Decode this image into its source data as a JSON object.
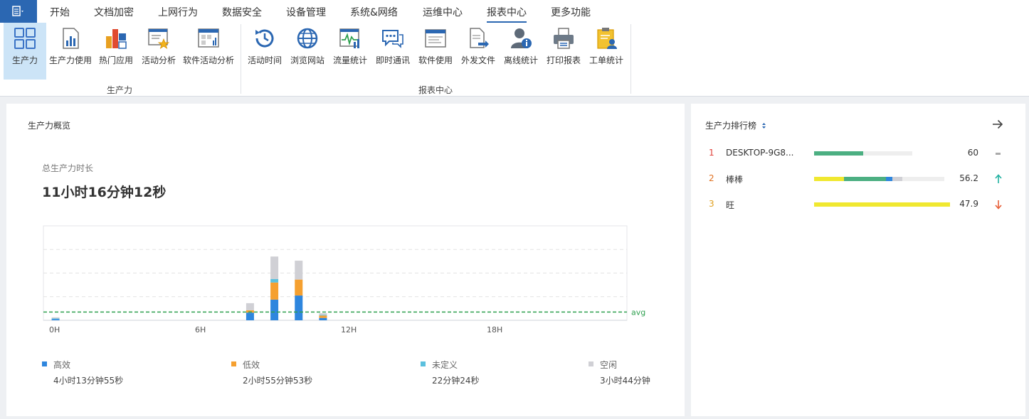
{
  "colors": {
    "accent": "#2b67b2",
    "high": "#2e86de",
    "low": "#f5a030",
    "undefined": "#5bc0de",
    "idle": "#d0d0d5",
    "avg_line": "#2ea04f",
    "rank1": "#e0403a",
    "rank2": "#e07020",
    "rank3": "#e0a020",
    "bar_green": "#4caf82",
    "bar_yellow": "#f0e830"
  },
  "menu": {
    "app_icon": "document-menu-icon",
    "items": [
      {
        "label": "开始",
        "active": false
      },
      {
        "label": "文档加密",
        "active": false
      },
      {
        "label": "上网行为",
        "active": false
      },
      {
        "label": "数据安全",
        "active": false
      },
      {
        "label": "设备管理",
        "active": false
      },
      {
        "label": "系统&网络",
        "active": false
      },
      {
        "label": "运维中心",
        "active": false
      },
      {
        "label": "报表中心",
        "active": true
      },
      {
        "label": "更多功能",
        "active": false
      }
    ]
  },
  "ribbon": {
    "groups": [
      {
        "label": "生产力"
      },
      {
        "label": "报表中心"
      }
    ],
    "tools": [
      {
        "label": "生产力",
        "icon": "productivity-grid-icon",
        "selected": true
      },
      {
        "label": "生产力使用",
        "icon": "bar-report-icon",
        "selected": false
      },
      {
        "label": "热门应用",
        "icon": "popular-apps-icon",
        "selected": false
      },
      {
        "label": "活动分析",
        "icon": "activity-star-icon",
        "selected": false
      },
      {
        "label": "软件活动分析",
        "icon": "software-activity-icon",
        "selected": false
      },
      {
        "label": "活动时间",
        "icon": "history-clock-icon",
        "selected": false
      },
      {
        "label": "浏览网站",
        "icon": "globe-icon",
        "selected": false
      },
      {
        "label": "流量统计",
        "icon": "traffic-chart-icon",
        "selected": false
      },
      {
        "label": "即时通讯",
        "icon": "chat-bubbles-icon",
        "selected": false
      },
      {
        "label": "软件使用",
        "icon": "software-window-icon",
        "selected": false
      },
      {
        "label": "外发文件",
        "icon": "outgoing-file-icon",
        "selected": false
      },
      {
        "label": "离线统计",
        "icon": "offline-user-icon",
        "selected": false
      },
      {
        "label": "打印报表",
        "icon": "printer-icon",
        "selected": false
      },
      {
        "label": "工单统计",
        "icon": "work-order-icon",
        "selected": false
      }
    ]
  },
  "overview": {
    "title": "生产力概览",
    "total_label": "总生产力时长",
    "total_value": "11小时16分钟12秒"
  },
  "chart_data": {
    "type": "bar",
    "stacked": true,
    "x": [
      0,
      1,
      2,
      3,
      4,
      5,
      6,
      7,
      8,
      9,
      10,
      11,
      12,
      13,
      14,
      15,
      16,
      17,
      18,
      19,
      20,
      21,
      22,
      23
    ],
    "x_tick_labels": [
      "0H",
      "6H",
      "12H",
      "18H"
    ],
    "series": [
      {
        "name": "高效",
        "color_key": "high",
        "values": [
          2,
          0,
          0,
          0,
          0,
          0,
          0,
          0,
          13,
          35,
          42,
          4,
          0,
          0,
          0,
          0,
          0,
          0,
          0,
          0,
          0,
          0,
          0,
          0
        ]
      },
      {
        "name": "低效",
        "color_key": "low",
        "values": [
          0,
          0,
          0,
          0,
          0,
          0,
          0,
          0,
          4,
          29,
          27,
          4,
          0,
          0,
          0,
          0,
          0,
          0,
          0,
          0,
          0,
          0,
          0,
          0
        ]
      },
      {
        "name": "未定义",
        "color_key": "undefined",
        "values": [
          1,
          0,
          0,
          0,
          0,
          0,
          0,
          0,
          0,
          6,
          0,
          1,
          0,
          0,
          0,
          0,
          0,
          0,
          0,
          0,
          0,
          0,
          0,
          0
        ]
      },
      {
        "name": "空闲",
        "color_key": "idle",
        "values": [
          2,
          0,
          0,
          0,
          0,
          0,
          0,
          0,
          12,
          38,
          32,
          3,
          0,
          0,
          0,
          0,
          0,
          0,
          0,
          0,
          0,
          0,
          0,
          0
        ]
      }
    ],
    "ylim": [
      0,
      160
    ],
    "avg": 14,
    "avg_label": "avg",
    "grid": true
  },
  "legend": [
    {
      "name": "高效",
      "value": "4小时13分钟55秒",
      "color_key": "high"
    },
    {
      "name": "低效",
      "value": "2小时55分钟53秒",
      "color_key": "low"
    },
    {
      "name": "未定义",
      "value": "22分钟24秒",
      "color_key": "undefined"
    },
    {
      "name": "空闲",
      "value": "3小时44分钟",
      "color_key": "idle"
    }
  ],
  "ranking": {
    "title": "生产力排行榜",
    "sort_icon": "sort-updown-icon",
    "arrow_icon": "arrow-right-icon",
    "rows": [
      {
        "rank": "1",
        "name": "DESKTOP-9G8...",
        "score": "60",
        "trend": "flat",
        "segments": [
          {
            "share": 0.5,
            "color_key": "bar_green"
          }
        ]
      },
      {
        "rank": "2",
        "name": "棒棒",
        "score": "56.2",
        "trend": "up",
        "segments": [
          {
            "share": 0.23,
            "color_key": "bar_yellow"
          },
          {
            "share": 0.32,
            "color_key": "bar_green"
          },
          {
            "share": 0.05,
            "color_key": "high"
          },
          {
            "share": 0.08,
            "color_key": "idle"
          }
        ]
      },
      {
        "rank": "3",
        "name": "旺",
        "score": "47.9",
        "trend": "down",
        "segments": [
          {
            "share": 1.0,
            "color_key": "bar_yellow"
          }
        ]
      }
    ]
  }
}
